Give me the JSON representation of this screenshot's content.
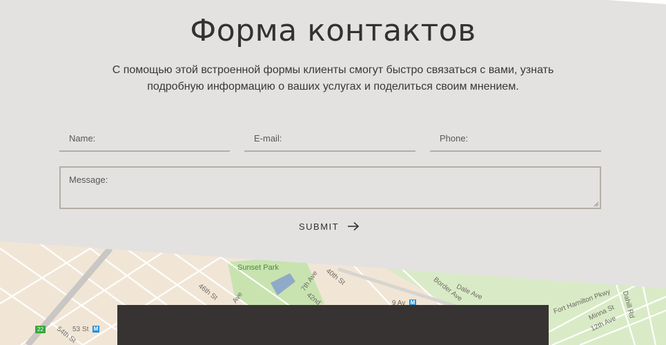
{
  "form": {
    "title": "Форма контактов",
    "subtitle": "С помощью этой встроенной формы клиенты смогут быстро связаться с вами, узнать подробную информацию о ваших услугах и поделиться своим мнением.",
    "name_placeholder": "Name:",
    "email_placeholder": "E-mail:",
    "phone_placeholder": "Phone:",
    "message_placeholder": "Message:",
    "submit_label": "SUBMIT"
  },
  "map": {
    "labels": {
      "sunset_park": "Sunset Park",
      "st_46": "46th St",
      "st_40": "40th St",
      "ave_7": "7th Ave",
      "st_42": "42nd",
      "av_9": "9 Av",
      "st_53": "53 St",
      "st_54": "54th St",
      "route_22": "22",
      "border_ave": "Border Ave",
      "dale_ave": "Dale Ave",
      "fort_hamilton": "Fort Hamilton Pkwy",
      "minna_st": "Minna St",
      "ave_12": "12th Ave",
      "dahill_rd": "Dahill Rd",
      "ave_label": "Ave"
    },
    "colors": {
      "land": "#f1e6d6",
      "park": "#c8e3b0",
      "road": "#ffffff",
      "highway": "#c9c7c4",
      "metro": "#2a8fd6"
    }
  }
}
